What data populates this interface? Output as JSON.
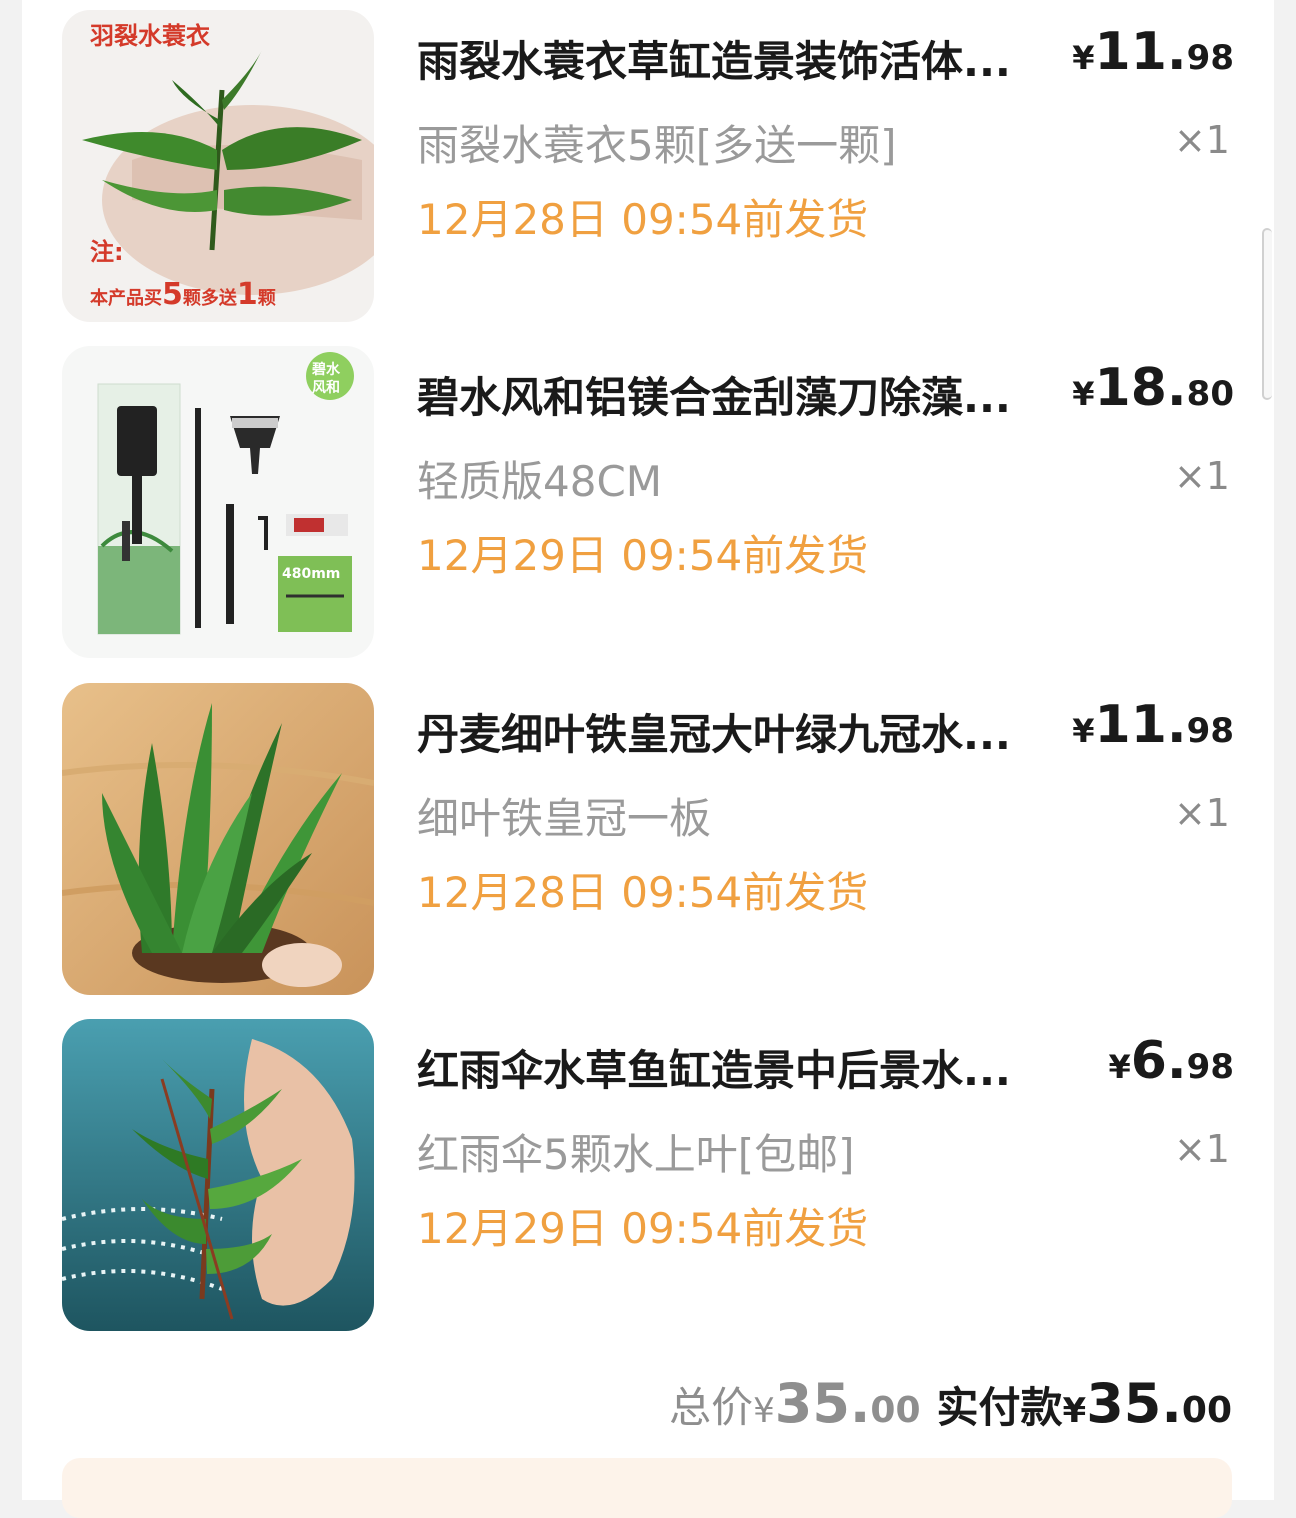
{
  "items": [
    {
      "title": "雨裂水蓑衣草缸造景装饰活体...",
      "price_currency": "¥",
      "price_int": "11.",
      "price_dec": "98",
      "spec": "雨裂水蓑衣5颗[多送一颗]",
      "qty": "×1",
      "ship": "12月28日 09:54前发货",
      "image_text": {
        "name": "羽裂水蓑衣",
        "note_label": "注:",
        "note_prefix": "本产品买",
        "note_buy": "5",
        "note_mid": "颗多送",
        "note_free": "1",
        "note_suffix": "颗"
      }
    },
    {
      "title": "碧水风和铝镁合金刮藻刀除藻...",
      "price_currency": "¥",
      "price_int": "18.",
      "price_dec": "80",
      "spec": "轻质版48CM",
      "qty": "×1",
      "ship": "12月29日 09:54前发货",
      "image_text": {
        "logo_line1": "碧水",
        "logo_line2": "风和",
        "size": "480mm"
      }
    },
    {
      "title": "丹麦细叶铁皇冠大叶绿九冠水...",
      "price_currency": "¥",
      "price_int": "11.",
      "price_dec": "98",
      "spec": "细叶铁皇冠一板",
      "qty": "×1",
      "ship": "12月28日 09:54前发货"
    },
    {
      "title": "红雨伞水草鱼缸造景中后景水...",
      "price_currency": "¥",
      "price_int": "6.",
      "price_dec": "98",
      "spec": "红雨伞5颗水上叶[包邮]",
      "qty": "×1",
      "ship": "12月29日 09:54前发货"
    }
  ],
  "summary": {
    "total_label": "总价",
    "total_currency": "¥",
    "total_int": "35.",
    "total_dec": "00",
    "paid_label": "实付款",
    "paid_currency": "¥",
    "paid_int": "35.",
    "paid_dec": "00"
  },
  "colors": {
    "ship_text": "#f0a040",
    "title_text": "#1a1a1a",
    "spec_text": "#9a9a9a"
  }
}
